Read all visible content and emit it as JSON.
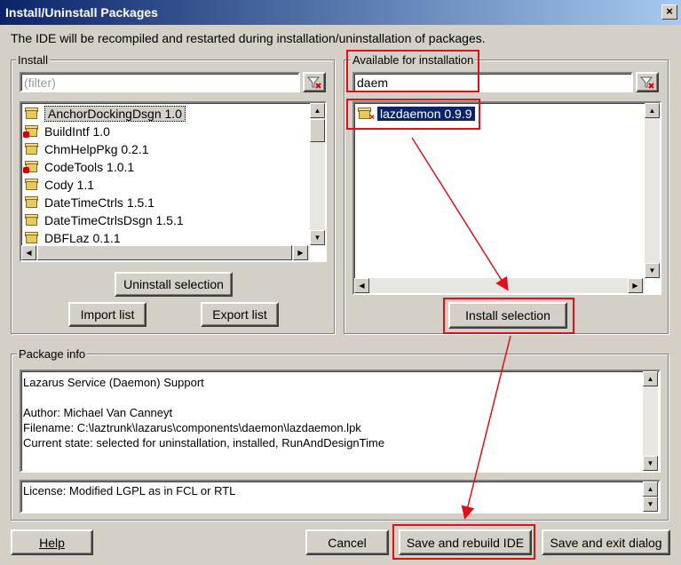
{
  "window": {
    "title": "Install/Uninstall Packages",
    "close_glyph": "×"
  },
  "info_text": "The IDE will be recompiled and restarted during installation/uninstallation of packages.",
  "install": {
    "group_label": "Install",
    "filter_placeholder": "(filter)",
    "items": [
      {
        "label": "AnchorDockingDsgn 1.0",
        "badge": false
      },
      {
        "label": "BuildIntf 1.0",
        "badge": true
      },
      {
        "label": "ChmHelpPkg 0.2.1",
        "badge": false
      },
      {
        "label": "CodeTools 1.0.1",
        "badge": true
      },
      {
        "label": "Cody 1.1",
        "badge": false
      },
      {
        "label": "DateTimeCtrls 1.5.1",
        "badge": false
      },
      {
        "label": "DateTimeCtrlsDsgn 1.5.1",
        "badge": false
      },
      {
        "label": "DBFLaz 0.1.1",
        "badge": false
      }
    ],
    "uninstall_button": "Uninstall selection",
    "import_button": "Import list",
    "export_button": "Export list"
  },
  "available": {
    "group_label": "Available for installation",
    "filter_value": "daem",
    "items": [
      {
        "label": "lazdaemon 0.9.9"
      }
    ],
    "install_button": "Install selection"
  },
  "package_info": {
    "group_label": "Package info",
    "lines": [
      "Lazarus Service (Daemon) Support",
      "",
      "Author: Michael Van Canneyt",
      "Filename:  C:\\laztrunk\\lazarus\\components\\daemon\\lazdaemon.lpk",
      "Current state: selected for uninstallation, installed, RunAndDesignTime"
    ],
    "license": "License: Modified LGPL as in FCL or RTL"
  },
  "buttons": {
    "help": "Help",
    "cancel": "Cancel",
    "save_rebuild": "Save and rebuild IDE",
    "save_exit": "Save and exit dialog"
  },
  "annotation_color": "#e0101a",
  "icons": {
    "filter_clear": "filter-clear-icon",
    "package": "package-icon"
  }
}
